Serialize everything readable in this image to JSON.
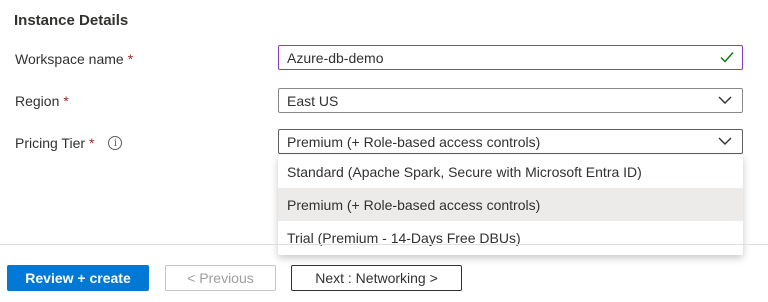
{
  "section": {
    "title": "Instance Details"
  },
  "fields": {
    "workspace": {
      "label": "Workspace name",
      "required_mark": "*",
      "value": "Azure-db-demo",
      "valid_icon": "checkmark-icon"
    },
    "region": {
      "label": "Region",
      "required_mark": "*",
      "value": "East US",
      "icon": "chevron-down-icon"
    },
    "pricing": {
      "label": "Pricing Tier",
      "required_mark": "*",
      "info_glyph": "i",
      "info_icon": "info-icon",
      "value": "Premium (+ Role-based access controls)",
      "icon": "chevron-down-icon"
    }
  },
  "dropdown": {
    "options": [
      {
        "label": "Standard (Apache Spark, Secure with Microsoft Entra ID)",
        "selected": false
      },
      {
        "label": "Premium (+ Role-based access controls)",
        "selected": true
      },
      {
        "label": "Trial (Premium - 14-Days Free DBUs)",
        "selected": false
      }
    ]
  },
  "footer": {
    "review_label": "Review + create",
    "previous_label": "< Previous",
    "next_label": "Next : Networking >"
  },
  "colors": {
    "primary": "#0078d4",
    "required": "#a4262c",
    "valid_check": "#107c10",
    "active_border": "#8a3dba",
    "selected_option_bg": "#edebe9"
  }
}
